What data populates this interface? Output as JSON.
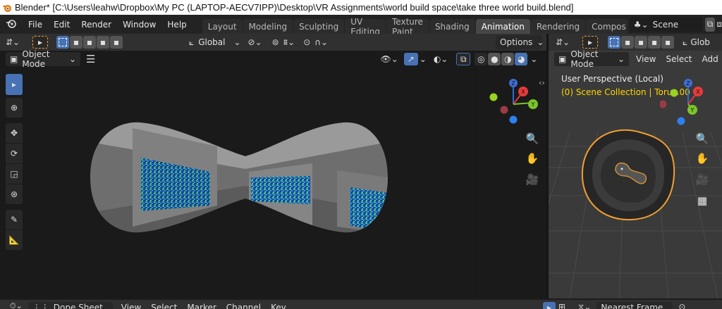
{
  "window": {
    "title": "Blender* [C:\\Users\\leahw\\Dropbox\\My PC (LAPTOP-AECV7IPP)\\Desktop\\VR Assignments\\world build space\\take three world build.blend]"
  },
  "menu": {
    "file": "File",
    "edit": "Edit",
    "render": "Render",
    "window": "Window",
    "help": "Help"
  },
  "workspaces": {
    "tabs": [
      "Layout",
      "Modeling",
      "Sculpting",
      "UV Editing",
      "Texture Paint",
      "Shading",
      "Animation",
      "Rendering",
      "Compos"
    ],
    "active": "Animation"
  },
  "scene": {
    "name": "Scene"
  },
  "toolbar": {
    "orientation": "Global",
    "options": "Options"
  },
  "viewport_left": {
    "mode": "Object Mode"
  },
  "viewport_right": {
    "mode": "Object Mode",
    "menu": {
      "view": "View",
      "select": "Select",
      "add": "Add"
    },
    "orientation_partial": "Glob",
    "perspective": "User Perspective (Local)",
    "collection": "(0) Scene Collection | Torus.00"
  },
  "timeline": {
    "editor": "Dope Sheet",
    "menu": {
      "view": "View",
      "select": "Select",
      "marker": "Marker",
      "channel": "Channel",
      "key": "Key"
    },
    "interpolation": "Nearest Frame"
  },
  "colors": {
    "accent": "#4772b3",
    "active_tab": "#474747",
    "selection_outline": "#f0a030",
    "status_text": "#ffd700"
  },
  "gizmo": {
    "x": "X",
    "y": "Y",
    "z": "Z"
  }
}
